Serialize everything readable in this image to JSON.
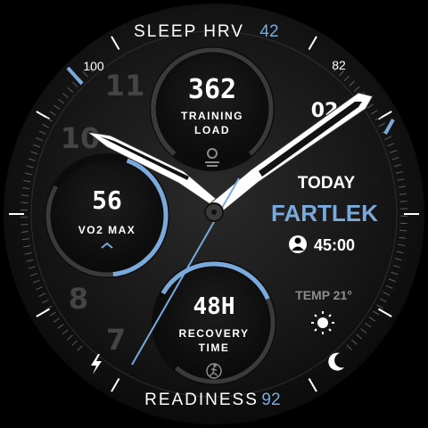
{
  "top_arc": {
    "label": "SLEEP HRV",
    "value": "42"
  },
  "bottom_arc": {
    "label": "READINESS",
    "value": "92"
  },
  "bezel": {
    "left_value": "100",
    "right_value": "82"
  },
  "dial_numerals": [
    "11",
    "10",
    "8",
    "7"
  ],
  "date_partial": "02",
  "subdial_top": {
    "value": "362",
    "label_line1": "TRAINING",
    "label_line2": "LOAD",
    "icon": "device-icon",
    "level": 0.3
  },
  "subdial_left": {
    "value": "56",
    "label": "VO2 MAX",
    "icon": "chevron-up-icon",
    "level": 0.55
  },
  "subdial_bottom": {
    "value": "48H",
    "label_line1": "RECOVERY",
    "label_line2": "TIME",
    "icon": "runner-icon",
    "level": 0.45
  },
  "workout": {
    "day": "TODAY",
    "name": "FARTLEK",
    "duration": "45:00",
    "icon": "person-icon"
  },
  "weather": {
    "label": "TEMP 21°",
    "icon": "sun-icon"
  },
  "corner_icons": {
    "left": "lightning-icon",
    "right": "moon-icon"
  },
  "colors": {
    "accent": "#7aa9dc",
    "face": "#1a1a1a",
    "white": "#ffffff",
    "muted": "#8c8c8c"
  }
}
